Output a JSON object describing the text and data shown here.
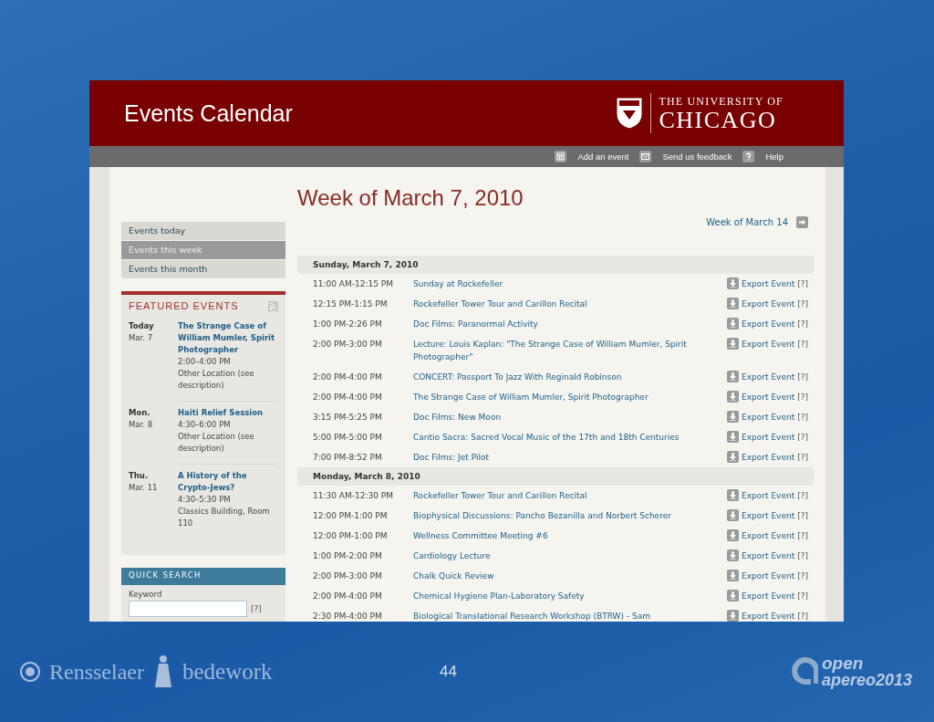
{
  "header": {
    "title": "Events Calendar",
    "logo_top": "THE UNIVERSITY OF",
    "logo_bottom": "CHICAGO"
  },
  "toolbar": [
    {
      "kind": "add",
      "label": "Add an event"
    },
    {
      "kind": "feedback",
      "label": "Send us feedback"
    },
    {
      "kind": "help",
      "label": "Help"
    }
  ],
  "sidebar": {
    "nav": [
      {
        "label": "Events today",
        "selected": false
      },
      {
        "label": "Events this week",
        "selected": true
      },
      {
        "label": "Events this month",
        "selected": false
      }
    ],
    "featured": {
      "title": "FEATURED EVENTS",
      "events": [
        {
          "day": "Today",
          "date": "Mar. 7",
          "title": "The Strange Case of William Mumler, Spirit Photographer",
          "time": "2:00–4:00 PM",
          "location": "Other Location (see description)"
        },
        {
          "day": "Mon.",
          "date": "Mar. 8",
          "title": "Haiti Relief Session",
          "time": "4:30–6:00 PM",
          "location": "Other Location (see description)"
        },
        {
          "day": "Thu.",
          "date": "Mar. 11",
          "title": "A History of the Crypto-Jews?",
          "time": "4:30–5:30 PM",
          "location": "Classics Building, Room 110"
        }
      ]
    },
    "quick_search": {
      "title": "QUICK SEARCH",
      "label": "Keyword",
      "help": "[?]"
    }
  },
  "main": {
    "title": "Week of March 7, 2010",
    "next_week": "Week of March 14",
    "days": [
      {
        "heading": "Sunday, March 7, 2010",
        "events": [
          {
            "time": "11:00 AM-12:15 PM",
            "title": "Sunday at Rockefeller",
            "export": "Export Event",
            "help": "[?]"
          },
          {
            "time": "12:15 PM-1:15 PM",
            "title": "Rockefeller Tower Tour and Carillon Recital",
            "export": "Export Event",
            "help": "[?]"
          },
          {
            "time": "1:00 PM-2:26 PM",
            "title": "Doc Films: Paranormal Activity",
            "export": "Export Event",
            "help": "[?]"
          },
          {
            "time": "2:00 PM-3:00 PM",
            "title": "Lecture: Louis Kaplan: \"The Strange Case of William Mumler, Spirit Photographer\"",
            "export": "Export Event",
            "help": "[?]"
          },
          {
            "time": "2:00 PM-4:00 PM",
            "title": "CONCERT: Passport To Jazz With Reginald Robinson",
            "export": "Export Event",
            "help": "[?]"
          },
          {
            "time": "2:00 PM-4:00 PM",
            "title": "The Strange Case of William Mumler, Spirit Photographer",
            "export": "Export Event",
            "help": "[?]"
          },
          {
            "time": "3:15 PM-5:25 PM",
            "title": "Doc Films: New Moon",
            "export": "Export Event",
            "help": "[?]"
          },
          {
            "time": "5:00 PM-5:00 PM",
            "title": "Cantio Sacra: Sacred Vocal Music of the 17th and 18th Centuries",
            "export": "Export Event",
            "help": "[?]"
          },
          {
            "time": "7:00 PM-8:52 PM",
            "title": "Doc Films: Jet Pilot",
            "export": "Export Event",
            "help": "[?]"
          }
        ]
      },
      {
        "heading": "Monday, March 8, 2010",
        "events": [
          {
            "time": "11:30 AM-12:30 PM",
            "title": "Rockefeller Tower Tour and Carillon Recital",
            "export": "Export Event",
            "help": "[?]"
          },
          {
            "time": "12:00 PM-1:00 PM",
            "title": "Biophysical Discussions: Pancho Bezanilla and Norbert Scherer",
            "export": "Export Event",
            "help": "[?]"
          },
          {
            "time": "12:00 PM-1:00 PM",
            "title": "Wellness Committee Meeting #6",
            "export": "Export Event",
            "help": "[?]"
          },
          {
            "time": "1:00 PM-2:00 PM",
            "title": "Cardiology Lecture",
            "export": "Export Event",
            "help": "[?]"
          },
          {
            "time": "2:00 PM-3:00 PM",
            "title": "Chalk Quick Review",
            "export": "Export Event",
            "help": "[?]"
          },
          {
            "time": "2:00 PM-4:00 PM",
            "title": "Chemical Hygiene Plan-Laboratory Safety",
            "export": "Export Event",
            "help": "[?]"
          },
          {
            "time": "2:30 PM-4:00 PM",
            "title": "Biological Translational Research Workshop (BTRW) - Sam",
            "export": "Export Event",
            "help": "[?]"
          }
        ]
      }
    ]
  },
  "slide_footer": {
    "left_logo": "Rensselaer",
    "middle_logo": "bedework",
    "page_number": "44",
    "right_logo_top": "open",
    "right_logo_bottom": "apereo2013"
  }
}
